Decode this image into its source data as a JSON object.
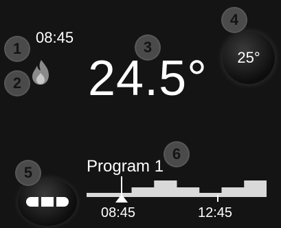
{
  "status": {
    "time": "08:45"
  },
  "current": {
    "temperature": "24.5°"
  },
  "setpoint": {
    "label": "25°"
  },
  "program": {
    "title": "Program 1",
    "current_marker_time": "08:45",
    "ticks": [
      "08:45",
      "12:45"
    ],
    "levels": [
      1,
      1,
      2,
      3,
      2,
      1,
      2,
      3
    ]
  },
  "badges": [
    "1",
    "2",
    "3",
    "4",
    "5",
    "6"
  ],
  "colors": {
    "background": "#141414",
    "text": "#ffffff",
    "timeline_fill": "#d9d9d9",
    "badge": "#4a4a4a"
  },
  "icons": {
    "heating": "flame-icon",
    "program_button": "segmented-bar-icon",
    "current_time_marker": "triangle-up-icon"
  }
}
